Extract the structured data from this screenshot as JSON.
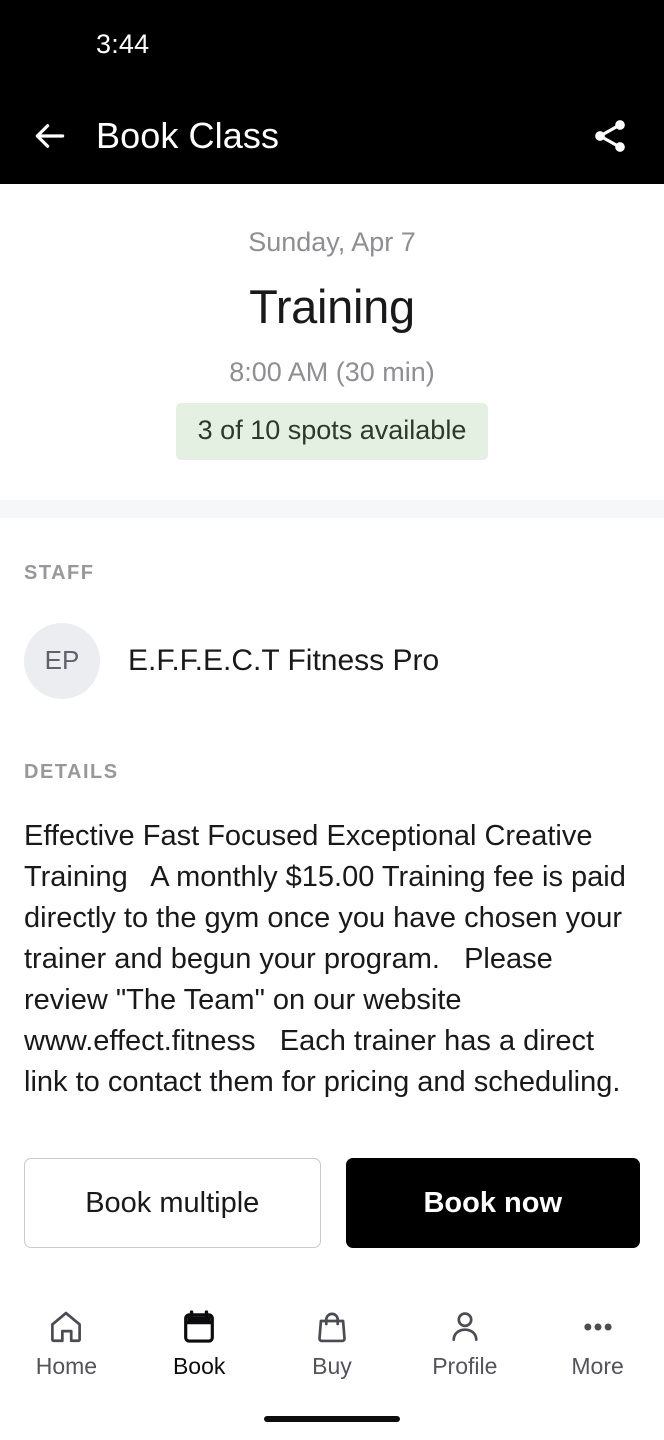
{
  "statusbar": {
    "time": "3:44"
  },
  "appbar": {
    "title": "Book Class",
    "back_icon": "arrow-left-icon",
    "share_icon": "share-icon"
  },
  "hero": {
    "date": "Sunday, Apr 7",
    "title": "Training",
    "time": "8:00 AM (30 min)",
    "availability": "3 of 10 spots available",
    "availability_bg": "#e4f1e2",
    "availability_color": "#2c3a2c"
  },
  "staff": {
    "section_label": "STAFF",
    "avatar_initials": "EP",
    "name": "E.F.F.E.C.T Fitness Pro"
  },
  "details": {
    "section_label": "DETAILS",
    "text": "Effective Fast Focused Exceptional Creative Training   A monthly $15.00 Training fee is paid directly to the gym once you have chosen your trainer and begun your program.   Please review \"The Team\" on our website www.effect.fitness   Each trainer has a direct link to contact them for pricing and scheduling."
  },
  "actions": {
    "secondary_label": "Book multiple",
    "primary_label": "Book now",
    "primary_bg": "#000000"
  },
  "bottomnav": {
    "items": [
      {
        "label": "Home",
        "icon": "home-icon",
        "active": false
      },
      {
        "label": "Book",
        "icon": "calendar-icon",
        "active": true
      },
      {
        "label": "Buy",
        "icon": "shopping-bag-icon",
        "active": false
      },
      {
        "label": "Profile",
        "icon": "person-icon",
        "active": false
      },
      {
        "label": "More",
        "icon": "more-dots-icon",
        "active": false
      }
    ]
  }
}
